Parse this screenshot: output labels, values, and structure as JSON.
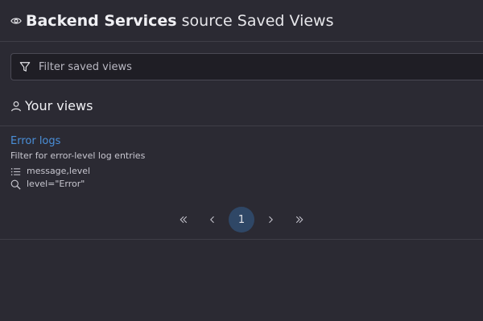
{
  "header": {
    "icon": "eye-icon",
    "title_main": "Backend Services",
    "title_rest": "source Saved Views"
  },
  "filter": {
    "icon": "filter-icon",
    "placeholder": "Filter saved views",
    "value": ""
  },
  "section": {
    "icon": "user-icon",
    "label": "Your views"
  },
  "views": [
    {
      "name": "Error logs",
      "description": "Filter for error-level log entries",
      "columns": "message,level",
      "columns_icon": "list-icon",
      "query": "level=\"Error\"",
      "query_icon": "search-icon"
    }
  ],
  "pagination": {
    "first": "«",
    "prev": "‹",
    "current": "1",
    "next": "›",
    "last": "»"
  },
  "colors": {
    "background": "#2b2a33",
    "link": "#4a8fd9",
    "active_page": "#2f4766"
  }
}
